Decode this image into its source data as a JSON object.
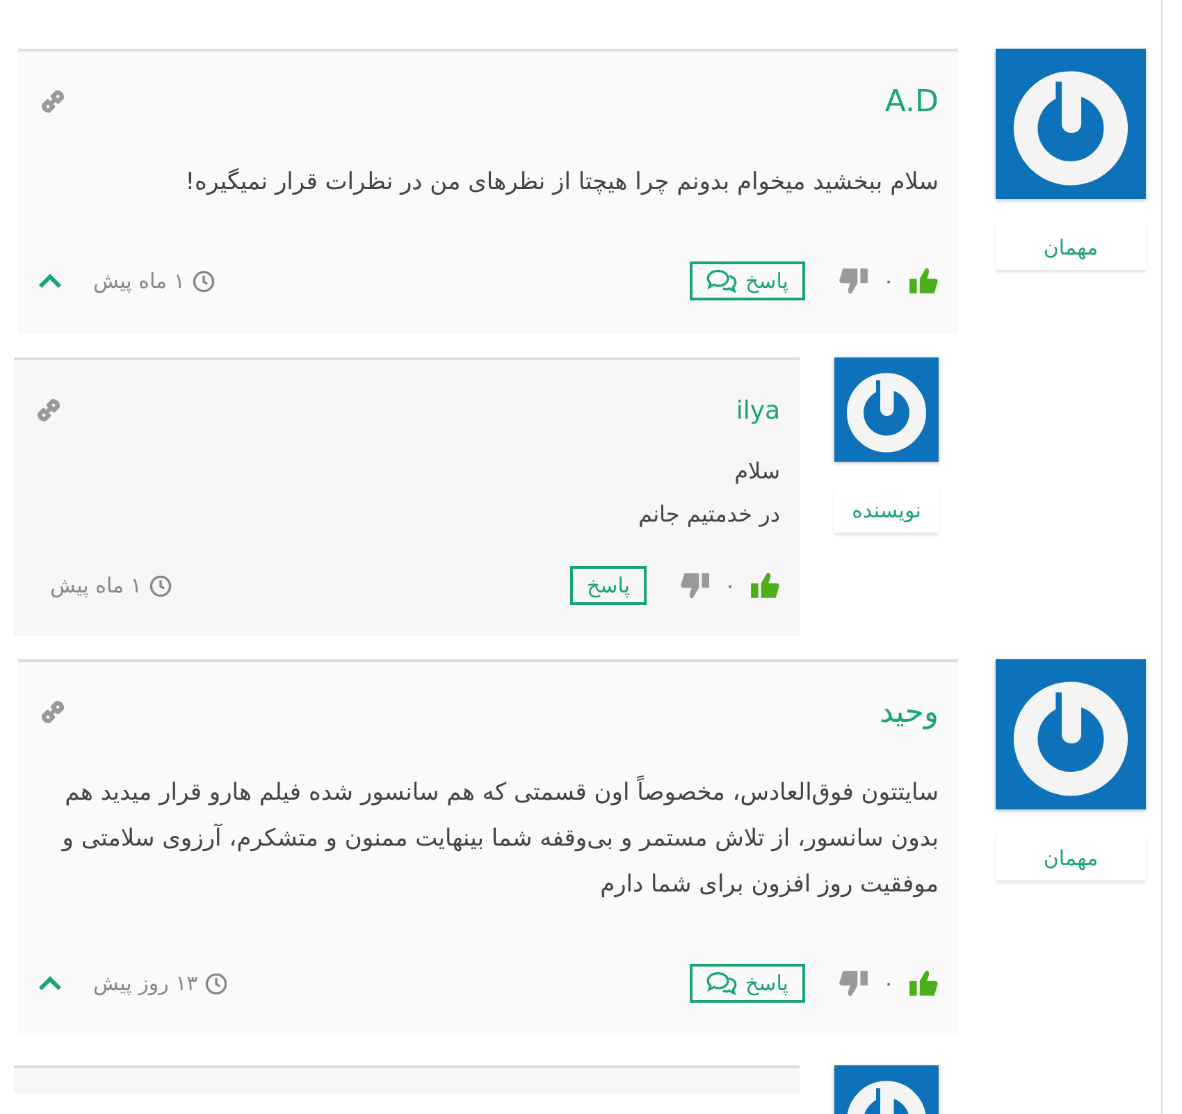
{
  "comments": [
    {
      "kind": "full",
      "author": "A.D",
      "role": "مهمان",
      "text": "سلام ببخشید میخوام بدونم چرا هیچتا از نظرهای من در نظرات قرار نمیگیره!",
      "likes": "۰",
      "reply_label": "پاسخ",
      "time": "۱ ماه پیش",
      "replies": [
        {
          "kind": "full",
          "author": "ilya",
          "role": "نویسنده",
          "text": "سلام\nدر خدمتیم جانم",
          "likes": "۰",
          "reply_label": "پاسخ",
          "time": "۱ ماه پیش"
        }
      ]
    },
    {
      "kind": "full",
      "author": "وحید",
      "role": "مهمان",
      "text": "سایتتون فوق‌العادس، مخصوصاً اون قسمتی که هم سانسور شده فیلم هارو قرار میدید هم بدون سانسور، از تلاش مستمر و بی‌وقفه شما بینهایت ممنون و متشکرم، آرزوی سلامتی و موفقیت روز افزون برای شما دارم",
      "likes": "۰",
      "reply_label": "پاسخ",
      "time": "۱۳ روز پیش",
      "replies": [
        {
          "kind": "partial"
        }
      ]
    }
  ]
}
